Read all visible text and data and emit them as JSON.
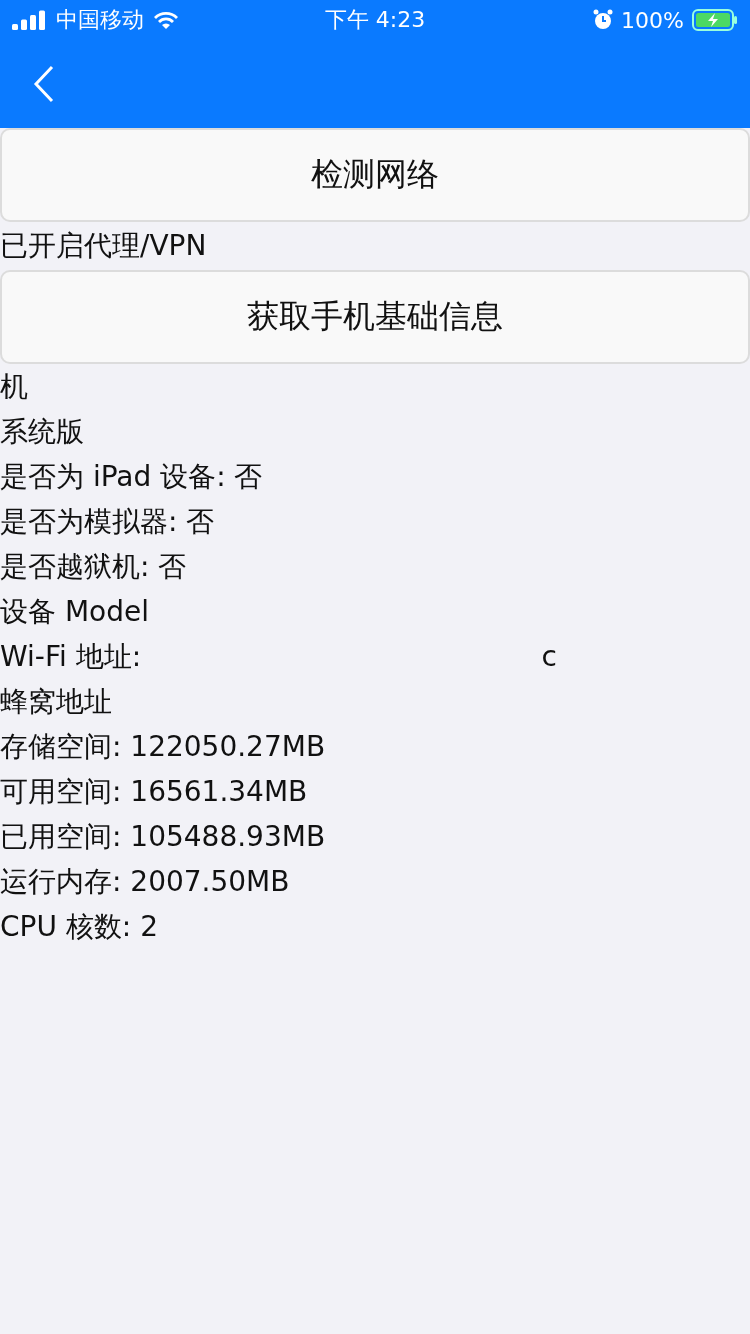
{
  "status_bar": {
    "carrier": "中国移动",
    "time": "下午 4:23",
    "battery": "100%",
    "charging": true
  },
  "network_button": "检测网络",
  "network_status": "已开启代理/VPN",
  "info_button": "获取手机基础信息",
  "info_lines": [
    {
      "text": "机"
    },
    {
      "text": "系统版"
    },
    {
      "text": "是否为 iPad 设备: 否"
    },
    {
      "text": "是否为模拟器: 否"
    },
    {
      "text": "是否越狱机: 否"
    },
    {
      "text": "设备 Model"
    },
    {
      "text": "Wi-Fi 地址:",
      "tail": "c"
    },
    {
      "text": "蜂窝地址"
    },
    {
      "text": "存储空间: 122050.27MB"
    },
    {
      "text": "可用空间: 16561.34MB"
    },
    {
      "text": "已用空间: 105488.93MB"
    },
    {
      "text": "运行内存: 2007.50MB"
    },
    {
      "text": "CPU 核数: 2"
    }
  ]
}
